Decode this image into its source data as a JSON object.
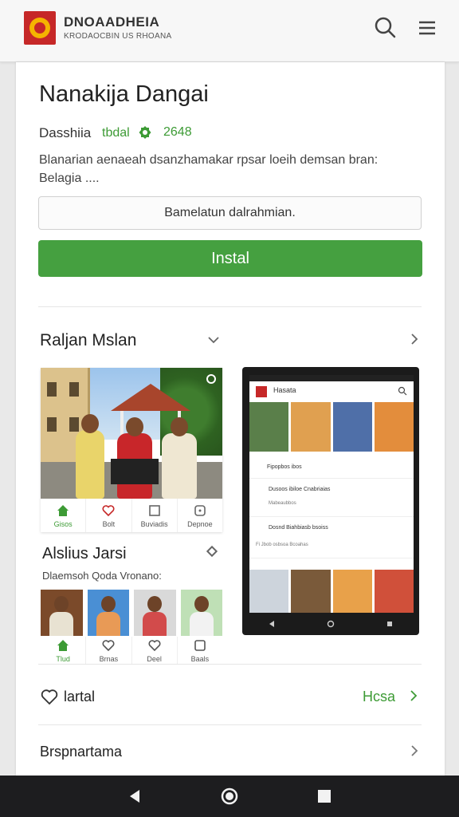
{
  "header": {
    "brand_title": "DNOAADHEIA",
    "brand_subtitle": "KRODAOCBIN US RHOANA",
    "icons": [
      "logo",
      "search-icon",
      "menu-icon"
    ]
  },
  "app": {
    "title": "Nanakija Dangai",
    "developer": "Dasshiia",
    "developer_tag": "tbdal",
    "count": "2648",
    "description": "Blanarian aenaeah dsanzhamakar rpsar loeih demsan bran: Belagia ....",
    "secondary_button": "Bamelatun dalrahmian.",
    "install_button": "Instal"
  },
  "section": {
    "title": "Raljan Mslan"
  },
  "left_panel": {
    "tabs": [
      {
        "label": "Gisos",
        "icon": "home-icon",
        "active": true
      },
      {
        "label": "Bolt",
        "icon": "heart-icon",
        "active": false
      },
      {
        "label": "Buviadis",
        "icon": "square-icon",
        "active": false
      },
      {
        "label": "Depnoe",
        "icon": "info-icon",
        "active": false
      }
    ],
    "sub_title": "Alslius Jarsi",
    "sub_desc": "Dlaemsoh Qoda Vronano:",
    "thumb_tabs": [
      {
        "label": "Tlud",
        "icon": "home-icon",
        "active": true
      },
      {
        "label": "Brnas",
        "icon": "heart-icon",
        "active": false
      },
      {
        "label": "Deel",
        "icon": "heart-icon",
        "active": false
      },
      {
        "label": "Baals",
        "icon": "square-icon",
        "active": false
      }
    ]
  },
  "phone": {
    "title": "Hasata",
    "rows": [
      {
        "text": "Fipopbos ibos",
        "sub": ""
      },
      {
        "text": "Dusoos ibiloe Cnabriaias",
        "sub": "Mabeaubbos"
      },
      {
        "text": "Dosnd Biahbiasb bsoiss",
        "sub": "Fi Jbob osbsoa Bcoahas"
      }
    ]
  },
  "rows": {
    "wishlist_label": "lartal",
    "wishlist_link": "Hcsa",
    "more_label": "Brspnartama"
  },
  "colors": {
    "accent_green": "#45a040",
    "logo_red": "#c62828",
    "logo_yellow": "#f5b400"
  }
}
